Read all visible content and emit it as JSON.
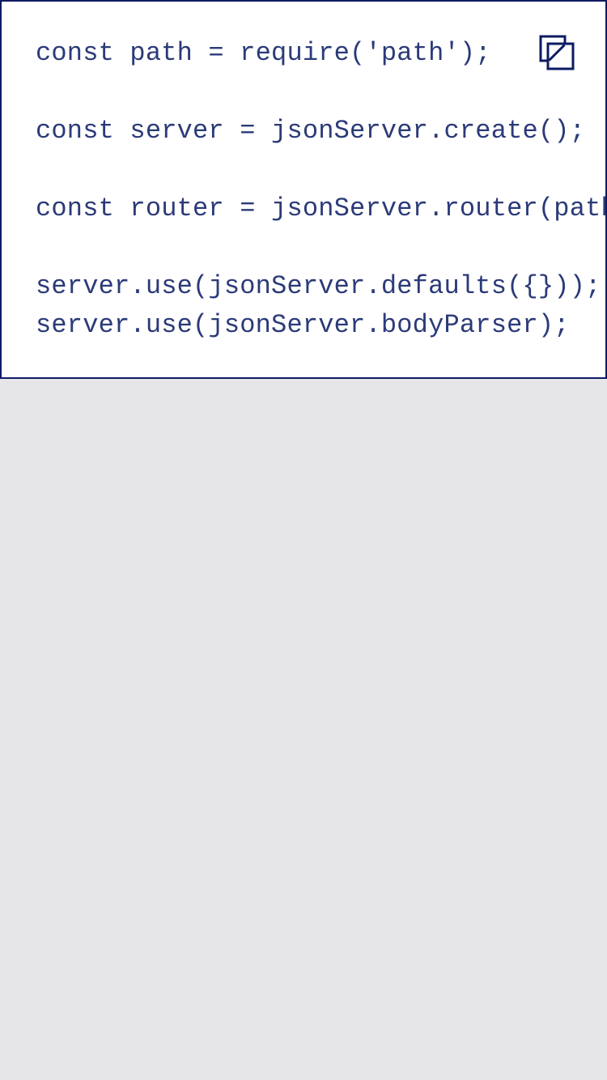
{
  "code": {
    "lines": [
      "const path = require('path');",
      "",
      "const server = jsonServer.create();",
      "",
      "const router = jsonServer.router(path",
      "",
      "server.use(jsonServer.defaults({}));",
      "server.use(jsonServer.bodyParser);"
    ]
  },
  "actions": {
    "copy_icon": "copy-icon"
  },
  "colors": {
    "page_background": "#e6e6e8",
    "card_background": "#ffffff",
    "border": "#0d1b63",
    "code_text": "#2b3a78"
  }
}
